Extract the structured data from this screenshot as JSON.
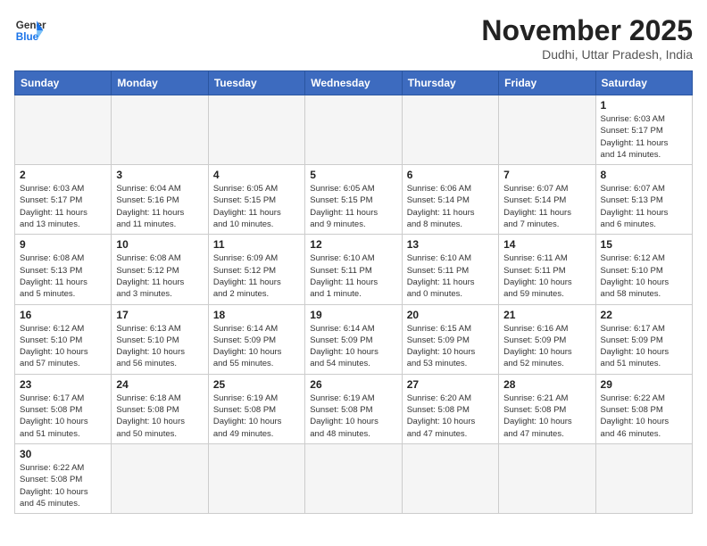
{
  "logo": {
    "line1": "General",
    "line2": "Blue"
  },
  "title": "November 2025",
  "subtitle": "Dudhi, Uttar Pradesh, India",
  "weekdays": [
    "Sunday",
    "Monday",
    "Tuesday",
    "Wednesday",
    "Thursday",
    "Friday",
    "Saturday"
  ],
  "weeks": [
    [
      {
        "day": "",
        "info": ""
      },
      {
        "day": "",
        "info": ""
      },
      {
        "day": "",
        "info": ""
      },
      {
        "day": "",
        "info": ""
      },
      {
        "day": "",
        "info": ""
      },
      {
        "day": "",
        "info": ""
      },
      {
        "day": "1",
        "info": "Sunrise: 6:03 AM\nSunset: 5:17 PM\nDaylight: 11 hours\nand 14 minutes."
      }
    ],
    [
      {
        "day": "2",
        "info": "Sunrise: 6:03 AM\nSunset: 5:17 PM\nDaylight: 11 hours\nand 13 minutes."
      },
      {
        "day": "3",
        "info": "Sunrise: 6:04 AM\nSunset: 5:16 PM\nDaylight: 11 hours\nand 11 minutes."
      },
      {
        "day": "4",
        "info": "Sunrise: 6:05 AM\nSunset: 5:15 PM\nDaylight: 11 hours\nand 10 minutes."
      },
      {
        "day": "5",
        "info": "Sunrise: 6:05 AM\nSunset: 5:15 PM\nDaylight: 11 hours\nand 9 minutes."
      },
      {
        "day": "6",
        "info": "Sunrise: 6:06 AM\nSunset: 5:14 PM\nDaylight: 11 hours\nand 8 minutes."
      },
      {
        "day": "7",
        "info": "Sunrise: 6:07 AM\nSunset: 5:14 PM\nDaylight: 11 hours\nand 7 minutes."
      },
      {
        "day": "8",
        "info": "Sunrise: 6:07 AM\nSunset: 5:13 PM\nDaylight: 11 hours\nand 6 minutes."
      }
    ],
    [
      {
        "day": "9",
        "info": "Sunrise: 6:08 AM\nSunset: 5:13 PM\nDaylight: 11 hours\nand 5 minutes."
      },
      {
        "day": "10",
        "info": "Sunrise: 6:08 AM\nSunset: 5:12 PM\nDaylight: 11 hours\nand 3 minutes."
      },
      {
        "day": "11",
        "info": "Sunrise: 6:09 AM\nSunset: 5:12 PM\nDaylight: 11 hours\nand 2 minutes."
      },
      {
        "day": "12",
        "info": "Sunrise: 6:10 AM\nSunset: 5:11 PM\nDaylight: 11 hours\nand 1 minute."
      },
      {
        "day": "13",
        "info": "Sunrise: 6:10 AM\nSunset: 5:11 PM\nDaylight: 11 hours\nand 0 minutes."
      },
      {
        "day": "14",
        "info": "Sunrise: 6:11 AM\nSunset: 5:11 PM\nDaylight: 10 hours\nand 59 minutes."
      },
      {
        "day": "15",
        "info": "Sunrise: 6:12 AM\nSunset: 5:10 PM\nDaylight: 10 hours\nand 58 minutes."
      }
    ],
    [
      {
        "day": "16",
        "info": "Sunrise: 6:12 AM\nSunset: 5:10 PM\nDaylight: 10 hours\nand 57 minutes."
      },
      {
        "day": "17",
        "info": "Sunrise: 6:13 AM\nSunset: 5:10 PM\nDaylight: 10 hours\nand 56 minutes."
      },
      {
        "day": "18",
        "info": "Sunrise: 6:14 AM\nSunset: 5:09 PM\nDaylight: 10 hours\nand 55 minutes."
      },
      {
        "day": "19",
        "info": "Sunrise: 6:14 AM\nSunset: 5:09 PM\nDaylight: 10 hours\nand 54 minutes."
      },
      {
        "day": "20",
        "info": "Sunrise: 6:15 AM\nSunset: 5:09 PM\nDaylight: 10 hours\nand 53 minutes."
      },
      {
        "day": "21",
        "info": "Sunrise: 6:16 AM\nSunset: 5:09 PM\nDaylight: 10 hours\nand 52 minutes."
      },
      {
        "day": "22",
        "info": "Sunrise: 6:17 AM\nSunset: 5:09 PM\nDaylight: 10 hours\nand 51 minutes."
      }
    ],
    [
      {
        "day": "23",
        "info": "Sunrise: 6:17 AM\nSunset: 5:08 PM\nDaylight: 10 hours\nand 51 minutes."
      },
      {
        "day": "24",
        "info": "Sunrise: 6:18 AM\nSunset: 5:08 PM\nDaylight: 10 hours\nand 50 minutes."
      },
      {
        "day": "25",
        "info": "Sunrise: 6:19 AM\nSunset: 5:08 PM\nDaylight: 10 hours\nand 49 minutes."
      },
      {
        "day": "26",
        "info": "Sunrise: 6:19 AM\nSunset: 5:08 PM\nDaylight: 10 hours\nand 48 minutes."
      },
      {
        "day": "27",
        "info": "Sunrise: 6:20 AM\nSunset: 5:08 PM\nDaylight: 10 hours\nand 47 minutes."
      },
      {
        "day": "28",
        "info": "Sunrise: 6:21 AM\nSunset: 5:08 PM\nDaylight: 10 hours\nand 47 minutes."
      },
      {
        "day": "29",
        "info": "Sunrise: 6:22 AM\nSunset: 5:08 PM\nDaylight: 10 hours\nand 46 minutes."
      }
    ],
    [
      {
        "day": "30",
        "info": "Sunrise: 6:22 AM\nSunset: 5:08 PM\nDaylight: 10 hours\nand 45 minutes."
      },
      {
        "day": "",
        "info": ""
      },
      {
        "day": "",
        "info": ""
      },
      {
        "day": "",
        "info": ""
      },
      {
        "day": "",
        "info": ""
      },
      {
        "day": "",
        "info": ""
      },
      {
        "day": "",
        "info": ""
      }
    ]
  ]
}
